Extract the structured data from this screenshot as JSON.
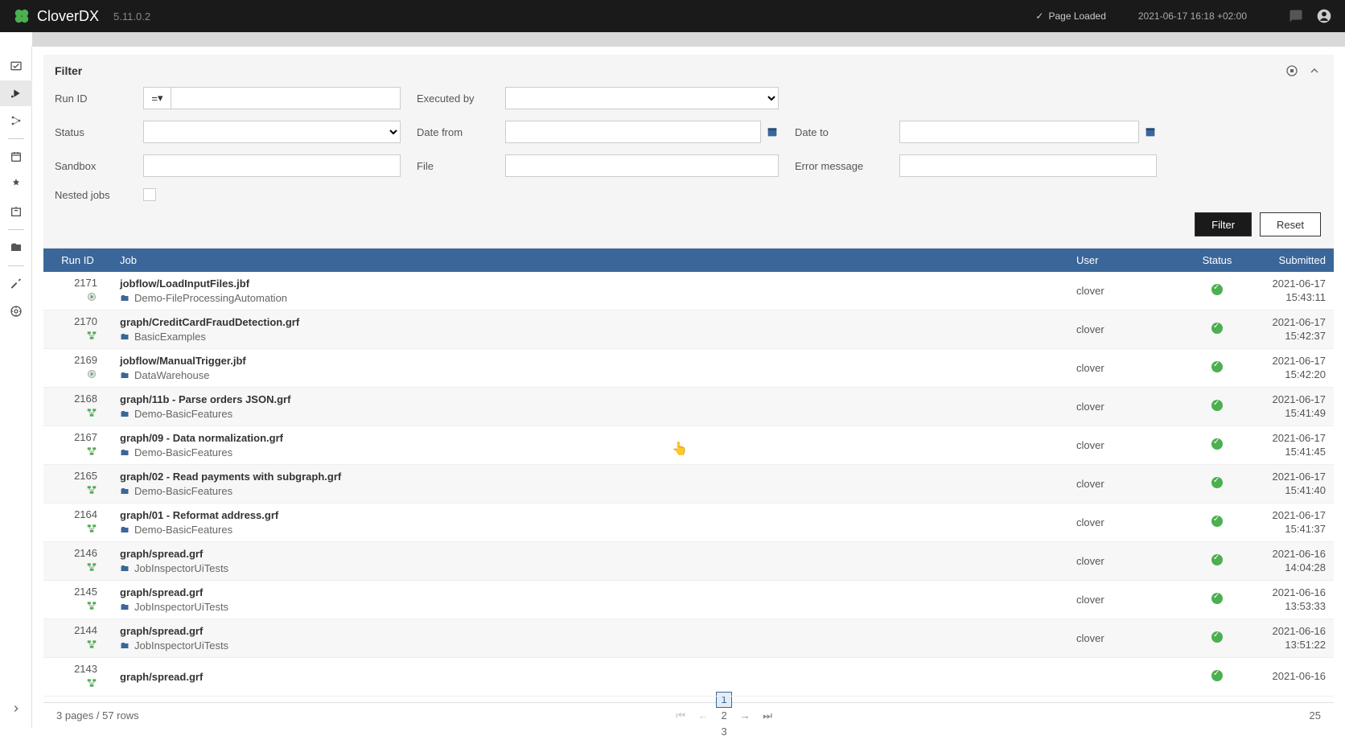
{
  "header": {
    "brand": "Clover",
    "brand_suffix": "DX",
    "version": "5.11.0.2",
    "status_text": "Page Loaded",
    "timestamp": "2021-06-17 16:18 +02:00"
  },
  "filter": {
    "title": "Filter",
    "labels": {
      "run_id": "Run ID",
      "status": "Status",
      "sandbox": "Sandbox",
      "nested_jobs": "Nested jobs",
      "executed_by": "Executed by",
      "date_from": "Date from",
      "file": "File",
      "date_to": "Date to",
      "error_message": "Error message"
    },
    "run_id_op": "=",
    "buttons": {
      "filter": "Filter",
      "reset": "Reset"
    }
  },
  "table": {
    "columns": {
      "run_id": "Run ID",
      "job": "Job",
      "user": "User",
      "status": "Status",
      "submitted": "Submitted"
    },
    "rows": [
      {
        "run_id": "2171",
        "type": "jobflow",
        "job": "jobflow/LoadInputFiles.jbf",
        "sandbox": "Demo-FileProcessingAutomation",
        "user": "clover",
        "date": "2021-06-17",
        "time": "15:43:11"
      },
      {
        "run_id": "2170",
        "type": "graph",
        "job": "graph/CreditCardFraudDetection.grf",
        "sandbox": "BasicExamples",
        "user": "clover",
        "date": "2021-06-17",
        "time": "15:42:37"
      },
      {
        "run_id": "2169",
        "type": "jobflow",
        "job": "jobflow/ManualTrigger.jbf",
        "sandbox": "DataWarehouse",
        "user": "clover",
        "date": "2021-06-17",
        "time": "15:42:20"
      },
      {
        "run_id": "2168",
        "type": "graph",
        "job": "graph/11b - Parse orders JSON.grf",
        "sandbox": "Demo-BasicFeatures",
        "user": "clover",
        "date": "2021-06-17",
        "time": "15:41:49"
      },
      {
        "run_id": "2167",
        "type": "graph",
        "job": "graph/09 - Data normalization.grf",
        "sandbox": "Demo-BasicFeatures",
        "user": "clover",
        "date": "2021-06-17",
        "time": "15:41:45"
      },
      {
        "run_id": "2165",
        "type": "graph",
        "job": "graph/02 - Read payments with subgraph.grf",
        "sandbox": "Demo-BasicFeatures",
        "user": "clover",
        "date": "2021-06-17",
        "time": "15:41:40"
      },
      {
        "run_id": "2164",
        "type": "graph",
        "job": "graph/01 - Reformat address.grf",
        "sandbox": "Demo-BasicFeatures",
        "user": "clover",
        "date": "2021-06-17",
        "time": "15:41:37"
      },
      {
        "run_id": "2146",
        "type": "graph",
        "job": "graph/spread.grf",
        "sandbox": "JobInspectorUiTests",
        "user": "clover",
        "date": "2021-06-16",
        "time": "14:04:28"
      },
      {
        "run_id": "2145",
        "type": "graph",
        "job": "graph/spread.grf",
        "sandbox": "JobInspectorUiTests",
        "user": "clover",
        "date": "2021-06-16",
        "time": "13:53:33"
      },
      {
        "run_id": "2144",
        "type": "graph",
        "job": "graph/spread.grf",
        "sandbox": "JobInspectorUiTests",
        "user": "clover",
        "date": "2021-06-16",
        "time": "13:51:22"
      },
      {
        "run_id": "2143",
        "type": "graph",
        "job": "graph/spread.grf",
        "sandbox": "",
        "user": "",
        "date": "2021-06-16",
        "time": ""
      }
    ]
  },
  "pager": {
    "info": "3 pages / 57 rows",
    "pages": [
      "1",
      "2",
      "3"
    ],
    "current": "1",
    "row_count": "25"
  }
}
